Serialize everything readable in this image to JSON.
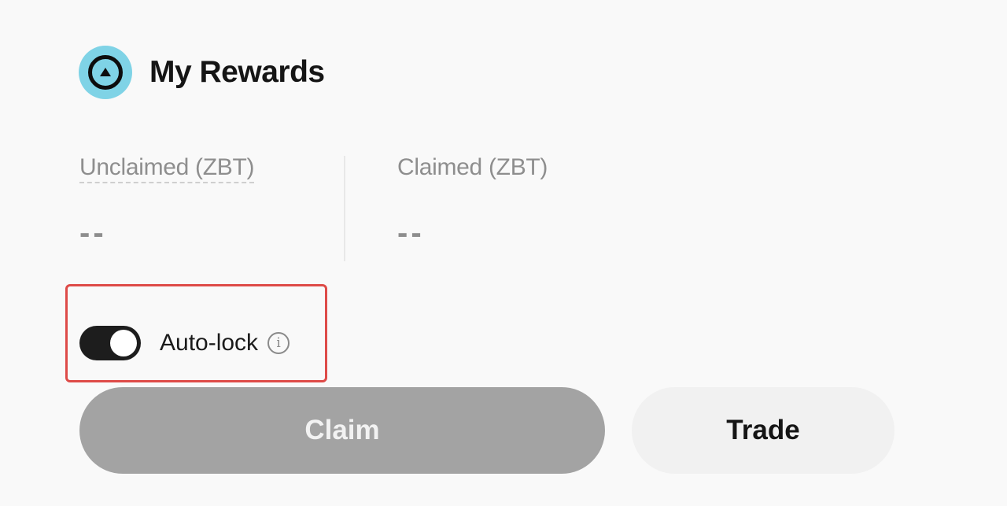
{
  "header": {
    "title": "My Rewards",
    "logo_icon": "brand-logo-icon"
  },
  "stats": {
    "unclaimed": {
      "label": "Unclaimed (ZBT)",
      "value": "--"
    },
    "claimed": {
      "label": "Claimed (ZBT)",
      "value": "--"
    }
  },
  "auto_lock": {
    "label": "Auto-lock",
    "enabled": true,
    "info_glyph": "i"
  },
  "buttons": {
    "claim_label": "Claim",
    "trade_label": "Trade"
  },
  "colors": {
    "logo_accent": "#7fd3e6",
    "highlight_border": "#de4b48",
    "claim_disabled_bg": "#a3a3a3",
    "toggle_on": "#1d1d1d"
  }
}
